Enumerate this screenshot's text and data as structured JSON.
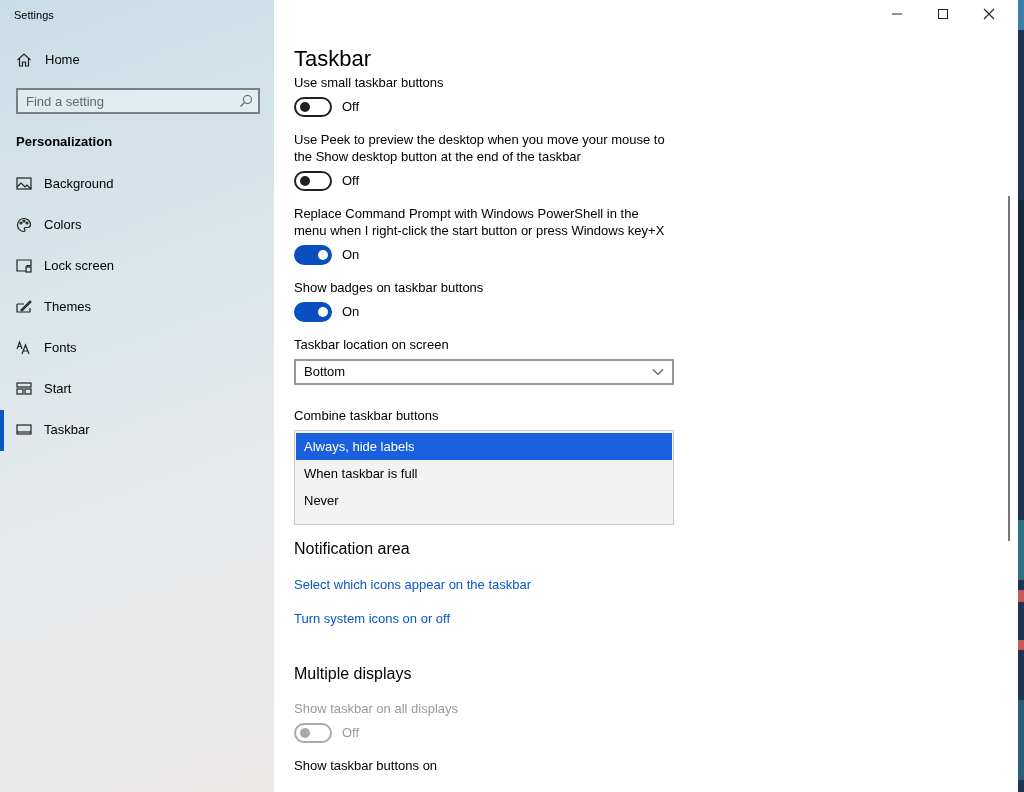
{
  "window": {
    "title": "Settings"
  },
  "sidebar": {
    "home": {
      "label": "Home"
    },
    "search": {
      "placeholder": "Find a setting"
    },
    "section": "Personalization",
    "items": [
      {
        "label": "Background",
        "selected": false
      },
      {
        "label": "Colors",
        "selected": false
      },
      {
        "label": "Lock screen",
        "selected": false
      },
      {
        "label": "Themes",
        "selected": false
      },
      {
        "label": "Fonts",
        "selected": false
      },
      {
        "label": "Start",
        "selected": false
      },
      {
        "label": "Taskbar",
        "selected": true
      }
    ]
  },
  "page": {
    "title": "Taskbar",
    "settings": [
      {
        "kind": "toggle",
        "label": "Use small taskbar buttons",
        "on": false,
        "disabled": false,
        "state_label": "Off"
      },
      {
        "kind": "toggle",
        "label": "Use Peek to preview the desktop when you move your mouse to the Show desktop button at the end of the taskbar",
        "on": false,
        "disabled": false,
        "state_label": "Off"
      },
      {
        "kind": "toggle",
        "label": "Replace Command Prompt with Windows PowerShell in the menu when I right-click the start button or press Windows key+X",
        "on": true,
        "disabled": false,
        "state_label": "On"
      },
      {
        "kind": "toggle",
        "label": "Show badges on taskbar buttons",
        "on": true,
        "disabled": false,
        "state_label": "On"
      },
      {
        "kind": "dropdown",
        "label": "Taskbar location on screen",
        "value": "Bottom"
      },
      {
        "kind": "listbox",
        "label": "Combine taskbar buttons",
        "options": [
          {
            "label": "Always, hide labels",
            "selected": true
          },
          {
            "label": "When taskbar is full",
            "selected": false
          },
          {
            "label": "Never",
            "selected": false
          }
        ]
      },
      {
        "kind": "heading",
        "label": "Notification area"
      },
      {
        "kind": "link",
        "label": "Select which icons appear on the taskbar"
      },
      {
        "kind": "link",
        "label": "Turn system icons on or off"
      },
      {
        "kind": "heading",
        "label": "Multiple displays"
      },
      {
        "kind": "toggle",
        "label": "Show taskbar on all displays",
        "on": false,
        "disabled": true,
        "state_label": "Off"
      },
      {
        "kind": "caption",
        "label": "Show taskbar buttons on"
      }
    ]
  }
}
